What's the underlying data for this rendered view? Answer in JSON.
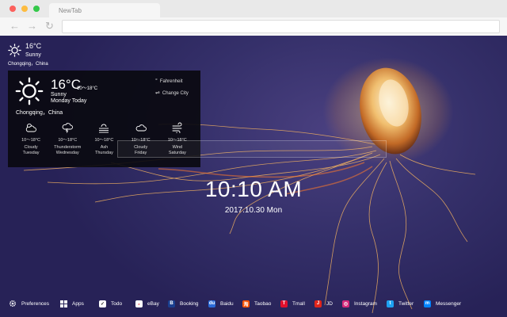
{
  "browser": {
    "tab_title": "NewTab",
    "nav": {
      "back": "←",
      "forward": "→",
      "reload": "↻"
    }
  },
  "mini_weather": {
    "temp": "16°C",
    "condition": "Sunny",
    "location": "Chongqing，China"
  },
  "weather_panel": {
    "temp": "16°C",
    "range": "10～18°C",
    "condition": "Sunny",
    "day": "Monday Today",
    "location": "Chongqing，China",
    "fahrenheit_label": "Fahrenheit",
    "change_city_label": "Change City",
    "forecast": [
      {
        "icon": "cloudy-sun-icon",
        "temp": "10～18°C",
        "condition": "Cloudy",
        "day": "Tuesday"
      },
      {
        "icon": "thunderstorm-icon",
        "temp": "10～18°C",
        "condition": "Thunderstorm",
        "day": "Wednesday"
      },
      {
        "icon": "ash-icon",
        "temp": "10～18°C",
        "condition": "Ash",
        "day": "Thursday"
      },
      {
        "icon": "cloud-icon",
        "temp": "10～18°C",
        "condition": "Cloudy",
        "day": "Friday"
      },
      {
        "icon": "wind-icon",
        "temp": "10～18°C",
        "condition": "Wind",
        "day": "Saturday"
      }
    ]
  },
  "search": {
    "placeholder": ""
  },
  "clock": {
    "time": "10:10 AM",
    "date": "2017.10.30 Mon"
  },
  "bottom_bar": {
    "preferences": "Preferences",
    "apps": "Apps",
    "links": [
      {
        "label": "Todo",
        "icon": "todo-icon",
        "color": "#ffffff"
      },
      {
        "label": "eBay",
        "icon": "ebay-icon",
        "color": "#ffffff"
      },
      {
        "label": "Booking",
        "icon": "booking-icon",
        "color": "#1a3f8f"
      },
      {
        "label": "Baidu",
        "icon": "baidu-icon",
        "color": "#2a6bd8"
      },
      {
        "label": "Taobao",
        "icon": "taobao-icon",
        "color": "#ff5000"
      },
      {
        "label": "Tmall",
        "icon": "tmall-icon",
        "color": "#e0102d"
      },
      {
        "label": "JD",
        "icon": "jd-icon",
        "color": "#e1251b"
      },
      {
        "label": "Instagram",
        "icon": "instagram-icon",
        "color": "#d6297a"
      },
      {
        "label": "Twitter",
        "icon": "twitter-icon",
        "color": "#1da1f2"
      },
      {
        "label": "Messenger",
        "icon": "messenger-icon",
        "color": "#0084ff"
      }
    ]
  }
}
